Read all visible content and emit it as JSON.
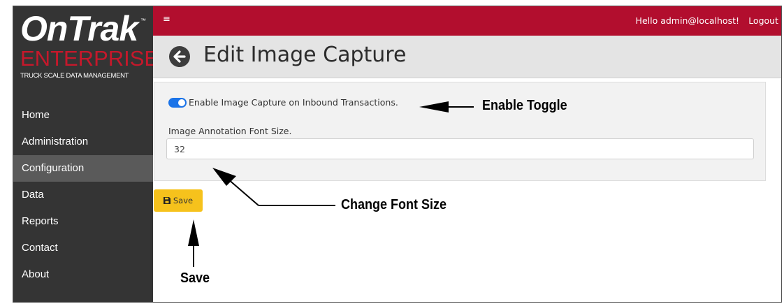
{
  "brand": {
    "logo_text": "OnTrak",
    "logo_tm": "™",
    "logo_sub": "ENTERPRISE",
    "tagline": "TRUCK SCALE DATA MANAGEMENT",
    "red": "#b20e2e",
    "logo_red": "#c5182b"
  },
  "sidebar": {
    "items": [
      {
        "label": "Home",
        "active": false
      },
      {
        "label": "Administration",
        "active": false
      },
      {
        "label": "Configuration",
        "active": true
      },
      {
        "label": "Data",
        "active": false
      },
      {
        "label": "Reports",
        "active": false
      },
      {
        "label": "Contact",
        "active": false
      },
      {
        "label": "About",
        "active": false
      }
    ]
  },
  "topbar": {
    "menu_icon": "hamburger-icon",
    "menu_glyph": "≡",
    "greeting": "Hello admin@localhost!",
    "logout": "Logout"
  },
  "header": {
    "back_icon": "arrow-left-circle-icon",
    "title": "Edit Image Capture"
  },
  "form": {
    "toggle_label": "Enable Image Capture on Inbound Transactions.",
    "toggle_on": true,
    "font_size_label": "Image Annotation Font Size.",
    "font_size_value": "32"
  },
  "actions": {
    "save_icon": "floppy-disk-icon",
    "save_label": "Save",
    "save_color": "#f6c21c"
  },
  "annotations": {
    "toggle": "Enable Toggle",
    "font_size": "Change Font Size",
    "save": "Save"
  }
}
